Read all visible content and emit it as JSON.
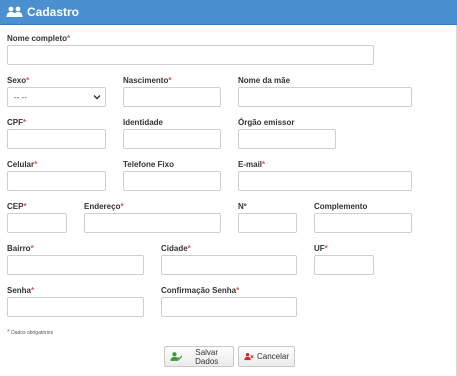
{
  "header": {
    "title": "Cadastro",
    "icon": "users-icon",
    "color": "#4a8fd0"
  },
  "labels": {
    "nome_completo": "Nome completo",
    "sexo": "Sexo",
    "nascimento": "Nascimento",
    "nome_mae": "Nome da mãe",
    "cpf": "CPF",
    "identidade": "Identidade",
    "orgao_emissor": "Órgão emissor",
    "celular": "Celular",
    "telefone_fixo": "Telefone Fixo",
    "email": "E-mail",
    "cep": "CEP",
    "endereco": "Endereço",
    "numero": "Nº",
    "complemento": "Complemento",
    "bairro": "Bairro",
    "cidade": "Cidade",
    "uf": "UF",
    "senha": "Senha",
    "confirmacao_senha": "Confirmação Senha"
  },
  "required_marker": "*",
  "sexo_select": {
    "selected": "-- --",
    "icon": "chevron-down-icon"
  },
  "footnote": "Dados obrigatórios",
  "buttons": {
    "save": {
      "label": "Salvar Dados",
      "icon": "user-check-icon"
    },
    "cancel": {
      "label": "Cancelar",
      "icon": "user-x-icon"
    }
  },
  "colors": {
    "required": "#d9534f",
    "save_icon": "#3a9a3a",
    "cancel_icon": "#c9302c"
  }
}
